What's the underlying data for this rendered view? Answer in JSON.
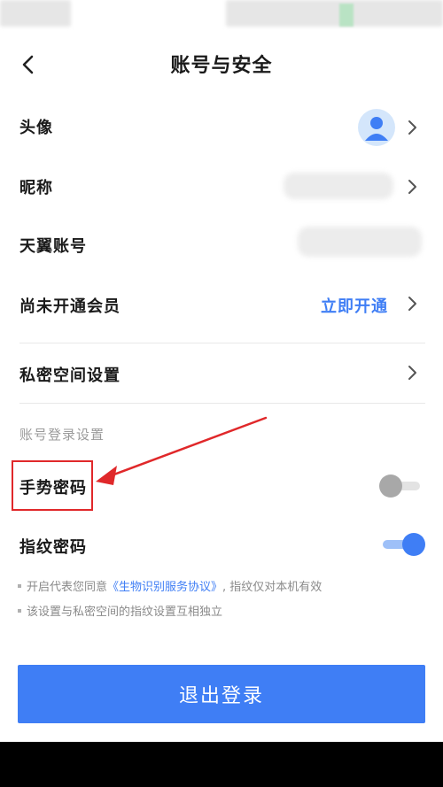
{
  "header": {
    "title": "账号与安全"
  },
  "rows": {
    "avatar": {
      "label": "头像"
    },
    "nickname": {
      "label": "昵称"
    },
    "account": {
      "label": "天翼账号"
    },
    "membership": {
      "label": "尚未开通会员",
      "action": "立即开通"
    },
    "private_space": {
      "label": "私密空间设置"
    }
  },
  "login_settings": {
    "section_title": "账号登录设置",
    "gesture": {
      "label": "手势密码",
      "enabled": false
    },
    "fingerprint": {
      "label": "指纹密码",
      "enabled": true
    }
  },
  "notes": {
    "line1_prefix": "开启代表您同意",
    "line1_link": "《生物识别服务协议》",
    "line1_suffix": ", 指纹仅对本机有效",
    "line2": "该设置与私密空间的指纹设置互相独立"
  },
  "logout": {
    "label": "退出登录"
  },
  "colors": {
    "accent": "#3f7ef5",
    "annotation": "#e0282a",
    "toggle_off": "#a8a8a8"
  },
  "icons": {
    "back": "chevron-left-icon",
    "chevron": "chevron-right-icon",
    "avatar": "user-avatar-icon"
  }
}
